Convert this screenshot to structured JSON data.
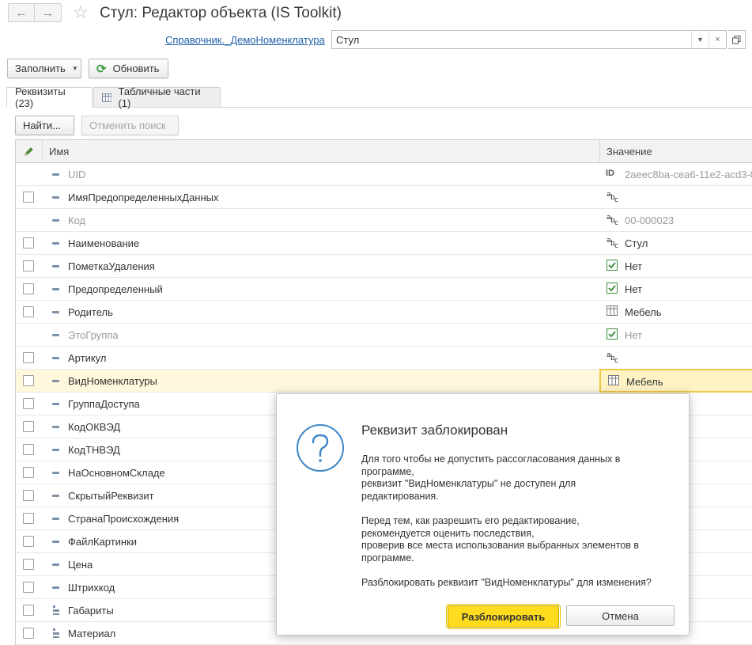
{
  "window": {
    "title": "Стул: Редактор объекта (IS Toolkit)"
  },
  "reference": {
    "link_label": "Справочник._ДемоНоменклатура",
    "value": "Стул"
  },
  "toolbar": {
    "fill_label": "Заполнить",
    "refresh_label": "Обновить"
  },
  "tabs": [
    {
      "label": "Реквизиты (23)",
      "active": true
    },
    {
      "label": "Табличные части (1)",
      "active": false
    }
  ],
  "search": {
    "find_label": "Найти...",
    "cancel_label": "Отменить поиск"
  },
  "grid": {
    "col_name": "Имя",
    "col_value": "Значение",
    "rows": [
      {
        "name": "UID",
        "value": "2aeec8ba-cea6-11e2-acd3-0",
        "value_icon": "id-icon",
        "muted": true,
        "checkbox": false,
        "kind": "dash"
      },
      {
        "name": "ИмяПредопределенныхДанных",
        "value": "",
        "value_icon": "string-type-icon",
        "muted": false,
        "checkbox": true,
        "kind": "dash"
      },
      {
        "name": "Код",
        "value": "00-000023",
        "value_icon": "string-type-icon",
        "muted": true,
        "checkbox": false,
        "kind": "dash"
      },
      {
        "name": "Наименование",
        "value": "Стул",
        "value_icon": "string-type-icon",
        "muted": false,
        "checkbox": true,
        "kind": "dash"
      },
      {
        "name": "ПометкаУдаления",
        "value": "Нет",
        "value_icon": "boolean-check-icon",
        "muted": false,
        "checkbox": true,
        "kind": "dash"
      },
      {
        "name": "Предопределенный",
        "value": "Нет",
        "value_icon": "boolean-check-icon",
        "muted": false,
        "checkbox": true,
        "kind": "dash"
      },
      {
        "name": "Родитель",
        "value": "Мебель",
        "value_icon": "table-ref-icon",
        "muted": false,
        "checkbox": true,
        "kind": "dash"
      },
      {
        "name": "ЭтоГруппа",
        "value": "Нет",
        "value_icon": "boolean-check-icon",
        "muted": true,
        "checkbox": false,
        "kind": "dash"
      },
      {
        "name": "Артикул",
        "value": "",
        "value_icon": "string-type-icon",
        "muted": false,
        "checkbox": true,
        "kind": "dash"
      },
      {
        "name": "ВидНоменклатуры",
        "value": "Мебель",
        "value_icon": "table-ref-icon",
        "muted": false,
        "checkbox": true,
        "kind": "dash",
        "selected": true
      },
      {
        "name": "ГруппаДоступа",
        "value": "",
        "value_icon": "",
        "muted": false,
        "checkbox": true,
        "kind": "dash"
      },
      {
        "name": "КодОКВЭД",
        "value": "",
        "value_icon": "",
        "muted": false,
        "checkbox": true,
        "kind": "dash"
      },
      {
        "name": "КодТНВЭД",
        "value": "",
        "value_icon": "",
        "muted": false,
        "checkbox": true,
        "kind": "dash"
      },
      {
        "name": "НаОсновномСкладе",
        "value": "",
        "value_icon": "",
        "muted": false,
        "checkbox": true,
        "kind": "dash"
      },
      {
        "name": "СкрытыйРеквизит",
        "value": "",
        "value_icon": "",
        "muted": false,
        "checkbox": true,
        "kind": "dash"
      },
      {
        "name": "СтранаПроисхождения",
        "value": "",
        "value_icon": "",
        "muted": false,
        "checkbox": true,
        "kind": "dash"
      },
      {
        "name": "ФайлКартинки",
        "value": "",
        "value_icon": "",
        "muted": false,
        "checkbox": true,
        "kind": "dash"
      },
      {
        "name": "Цена",
        "value": "",
        "value_icon": "",
        "muted": false,
        "checkbox": true,
        "kind": "dash"
      },
      {
        "name": "Штрихкод",
        "value": "",
        "value_icon": "",
        "muted": false,
        "checkbox": true,
        "kind": "dash"
      },
      {
        "name": "Габариты",
        "value": "",
        "value_icon": "",
        "muted": false,
        "checkbox": true,
        "kind": "sort"
      },
      {
        "name": "Материал",
        "value": "",
        "value_icon": "",
        "muted": false,
        "checkbox": true,
        "kind": "sort"
      }
    ]
  },
  "dialog": {
    "title": "Реквизит заблокирован",
    "paragraph1": [
      "Для того чтобы не допустить рассогласования данных в",
      "программе,",
      "реквизит \"ВидНоменклатуры\" не доступен для",
      "редактирования."
    ],
    "paragraph2": [
      "Перед тем, как разрешить его редактирование,",
      "рекомендуется оценить последствия,",
      "проверив все места использования выбранных элементов в",
      "программе."
    ],
    "question": "Разблокировать реквизит \"ВидНоменклатуры\" для изменения?",
    "unlock_label": "Разблокировать",
    "cancel_label": "Отмена"
  },
  "colors": {
    "accent_yellow": "#ffdc1e",
    "link_blue": "#1f5fa8",
    "selected_row": "#fff8dc",
    "question_icon": "#3f86c8"
  }
}
